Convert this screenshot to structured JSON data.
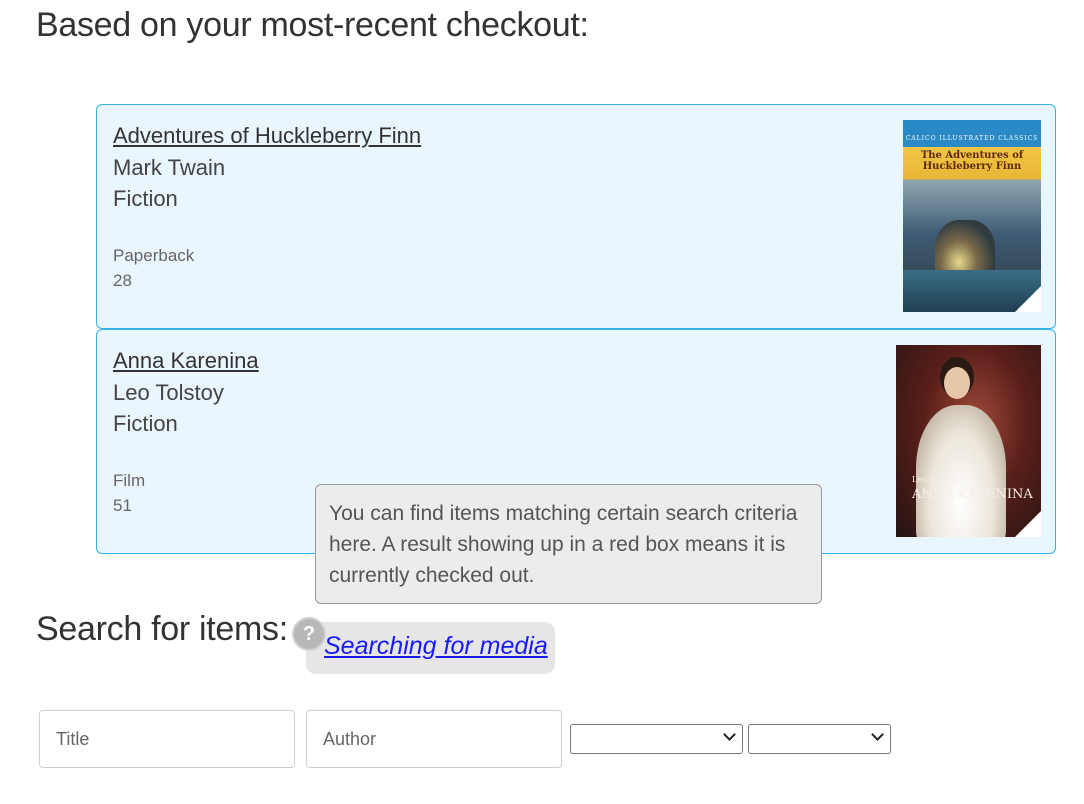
{
  "recommendations": {
    "heading": "Based on your most-recent checkout:",
    "items": [
      {
        "title": "Adventures of Huckleberry Finn",
        "author": "Mark Twain",
        "genre": "Fiction",
        "format": "Paperback",
        "count": "28",
        "cover": {
          "series_text": "CALICO ILLUSTRATED CLASSICS",
          "title_text": "The Adventures of Huckleberry Finn"
        }
      },
      {
        "title": "Anna Karenina",
        "author": "Leo Tolstoy",
        "genre": "Fiction",
        "format": "Film",
        "count": "51",
        "cover": {
          "author_text": "Leo Tolstoy",
          "title_text": "ANNA KARENINA"
        }
      }
    ]
  },
  "tooltip": {
    "text": "You can find items matching certain search criteria here. A result showing up in a red box means it is currently checked out."
  },
  "search": {
    "heading": "Search for items:",
    "help_icon": "question-mark-icon",
    "help_link": "Searching for media",
    "title_placeholder": "Title",
    "author_placeholder": "Author",
    "select1_value": "",
    "select2_value": ""
  }
}
